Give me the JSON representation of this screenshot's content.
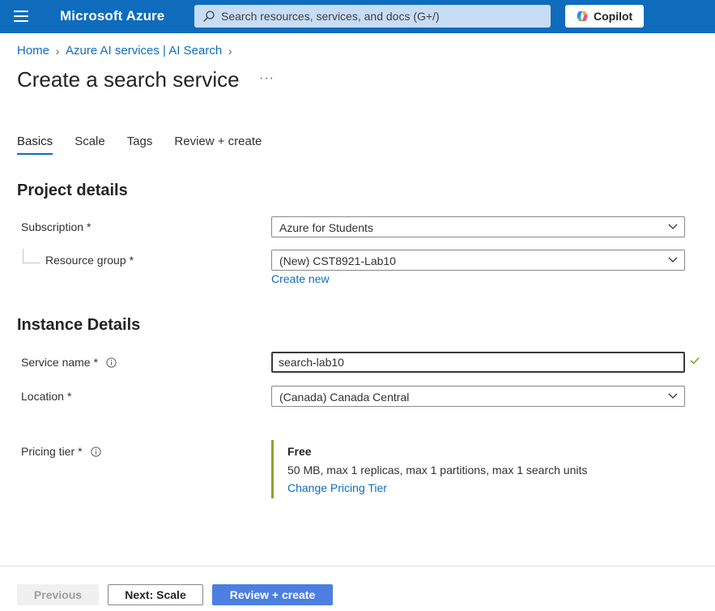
{
  "topbar": {
    "brand": "Microsoft Azure",
    "search_placeholder": "Search resources, services, and docs (G+/)",
    "copilot_label": "Copilot",
    "bg_color": "#0f6cbd"
  },
  "breadcrumb": {
    "items": [
      "Home",
      "Azure AI services | AI Search"
    ]
  },
  "page": {
    "title": "Create a search service",
    "more_label": "···"
  },
  "tabs": [
    {
      "label": "Basics",
      "active": true
    },
    {
      "label": "Scale",
      "active": false
    },
    {
      "label": "Tags",
      "active": false
    },
    {
      "label": "Review + create",
      "active": false
    }
  ],
  "project_details": {
    "title": "Project details",
    "subscription": {
      "label": "Subscription",
      "required": "*",
      "value": "Azure for Students"
    },
    "resource_group": {
      "label": "Resource group",
      "required": "*",
      "value": "(New) CST8921-Lab10",
      "create_new": "Create new"
    }
  },
  "instance_details": {
    "title": "Instance Details",
    "service_name": {
      "label": "Service name",
      "required": "*",
      "value": "search-lab10"
    },
    "location": {
      "label": "Location",
      "required": "*",
      "value": "(Canada) Canada Central"
    },
    "pricing_tier": {
      "label": "Pricing tier",
      "required": "*",
      "name": "Free",
      "description": "50 MB, max 1 replicas, max 1 partitions, max 1 search units",
      "change_link": "Change Pricing Tier",
      "accent_color": "#8ba62d"
    }
  },
  "footer": {
    "previous_label": "Previous",
    "next_label": "Next: Scale",
    "review_label": "Review + create",
    "primary_color": "#4c7fe0"
  }
}
